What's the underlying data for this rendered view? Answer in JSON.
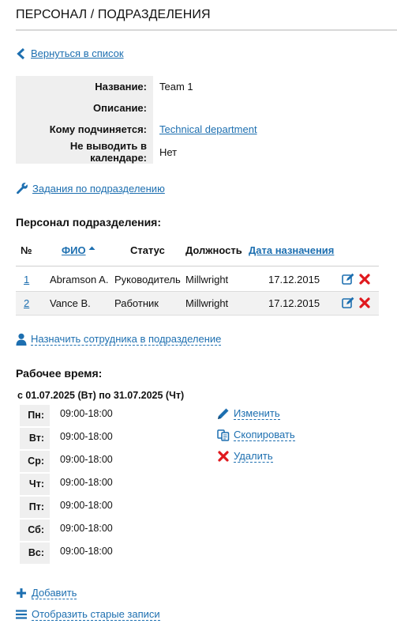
{
  "page": {
    "title": "ПЕРСОНАЛ / ПОДРАЗДЕЛЕНИЯ"
  },
  "back_link": "Вернуться в список",
  "info": [
    {
      "label": "Название:",
      "value": "Team 1",
      "is_link": false
    },
    {
      "label": "Описание:",
      "value": "",
      "is_link": false
    },
    {
      "label": "Кому подчиняется:",
      "value": "Technical department",
      "is_link": true
    },
    {
      "label": "Не выводить в календаре:",
      "value": "Нет",
      "is_link": false
    }
  ],
  "tasks_link": "Задания по подразделению",
  "staff": {
    "title": "Персонал подразделения:",
    "columns": {
      "num": "№",
      "name": "ФИО",
      "status": "Статус",
      "position": "Должность",
      "date": "Дата назначения"
    },
    "rows": [
      {
        "num": "1",
        "name": "Abramson A.",
        "status": "Руководитель",
        "position": "Millwright",
        "date": "17.12.2015"
      },
      {
        "num": "2",
        "name": "Vance B.",
        "status": "Работник",
        "position": "Millwright",
        "date": "17.12.2015"
      }
    ]
  },
  "assign_link": "Назначить сотрудника в подразделение",
  "work_time": {
    "title": "Рабочее время:",
    "period": "с 01.07.2025 (Вт) по 31.07.2025 (Чт)",
    "days": [
      {
        "day": "Пн:",
        "hours": "09:00-18:00"
      },
      {
        "day": "Вт:",
        "hours": "09:00-18:00"
      },
      {
        "day": "Ср:",
        "hours": "09:00-18:00"
      },
      {
        "day": "Чт:",
        "hours": "09:00-18:00"
      },
      {
        "day": "Пт:",
        "hours": "09:00-18:00"
      },
      {
        "day": "Сб:",
        "hours": "09:00-18:00"
      },
      {
        "day": "Вс:",
        "hours": "09:00-18:00"
      }
    ],
    "actions": {
      "edit": "Изменить",
      "copy": "Скопировать",
      "delete": "Удалить"
    }
  },
  "add_link": "Добавить",
  "old_records_link": "Отобразить старые записи",
  "colors": {
    "link": "#1d6fb0",
    "delete": "#e0191e",
    "label_bg": "#efefef"
  }
}
